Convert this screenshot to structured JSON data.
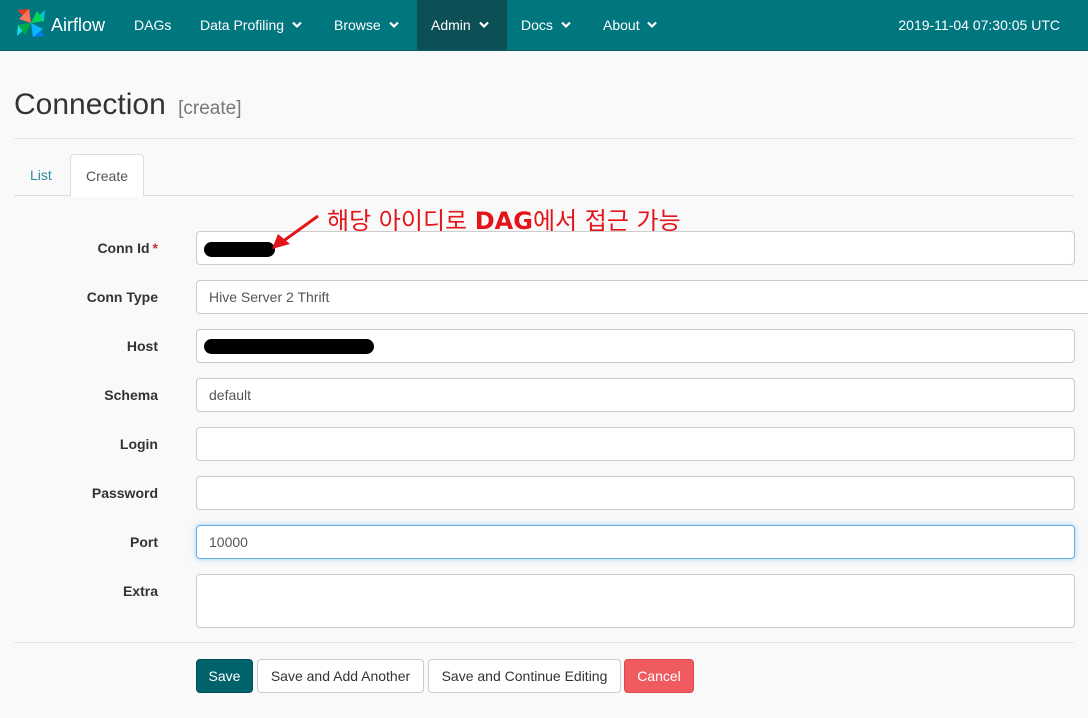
{
  "navbar": {
    "brand": "Airflow",
    "items": [
      {
        "label": "DAGs",
        "dropdown": false
      },
      {
        "label": "Data Profiling",
        "dropdown": true
      },
      {
        "label": "Browse",
        "dropdown": true
      },
      {
        "label": "Admin",
        "dropdown": true,
        "active": true
      },
      {
        "label": "Docs",
        "dropdown": true
      },
      {
        "label": "About",
        "dropdown": true
      }
    ],
    "datetime": "2019-11-04 07:30:05 UTC"
  },
  "page": {
    "title": "Connection",
    "subtitle": "[create]"
  },
  "tabs": [
    {
      "label": "List",
      "active": false
    },
    {
      "label": "Create",
      "active": true
    }
  ],
  "form": {
    "fields": [
      {
        "label": "Conn Id",
        "required": "*",
        "value": "",
        "redacted": true
      },
      {
        "label": "Conn Type",
        "value": "Hive Server 2 Thrift"
      },
      {
        "label": "Host",
        "value": "",
        "redacted": true
      },
      {
        "label": "Schema",
        "value": "default"
      },
      {
        "label": "Login",
        "value": ""
      },
      {
        "label": "Password",
        "value": ""
      },
      {
        "label": "Port",
        "value": "10000",
        "focused": true
      },
      {
        "label": "Extra",
        "value": ""
      }
    ]
  },
  "buttons": {
    "save": "Save",
    "save_add": "Save and Add Another",
    "save_continue": "Save and Continue Editing",
    "cancel": "Cancel"
  },
  "annotation": {
    "prefix": "해당 아이디로 ",
    "bold": "DAG",
    "suffix": "에서 접근 가능"
  },
  "colors": {
    "navbar": "#00767f",
    "active_nav": "#0c4f55",
    "save_button": "#00626b",
    "cancel_button": "#ef5b5f",
    "annotation": "#e3151b"
  },
  "icons": {
    "brand": "airflow-pinwheel-icon",
    "dropdown": "chevron-down-icon",
    "annotation": "red-arrow-icon"
  }
}
